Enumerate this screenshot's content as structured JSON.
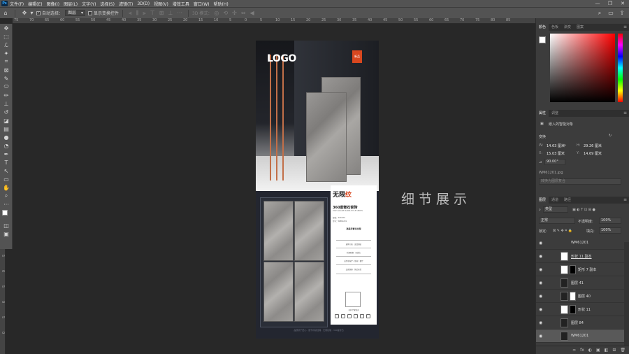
{
  "menubar": {
    "app_icon": "Ps",
    "items": [
      "文件(F)",
      "编辑(E)",
      "图像(I)",
      "图层(L)",
      "文字(Y)",
      "选择(S)",
      "滤镜(T)",
      "3D(D)",
      "视图(V)",
      "增效工具",
      "窗口(W)",
      "帮助(H)"
    ],
    "window_controls": [
      "—",
      "❐",
      "✕"
    ]
  },
  "options": {
    "auto_select_label": "自动选择：",
    "auto_select_value": "图层",
    "show_transform_label": "显示变换控件",
    "mode_3d": "3D 模式："
  },
  "ruler": {
    "h_ticks": [
      "75",
      "70",
      "65",
      "60",
      "55",
      "50",
      "45",
      "40",
      "35",
      "30",
      "25",
      "20",
      "15",
      "10",
      "5",
      "0",
      "5",
      "10",
      "15",
      "20",
      "25",
      "30",
      "35",
      "40",
      "45",
      "50",
      "55",
      "60",
      "65",
      "70",
      "75",
      "80",
      "85"
    ],
    "v_ticks": [
      "5",
      "0",
      "5",
      "0",
      "5",
      "0",
      "5",
      "0",
      "5",
      "0",
      "5",
      "0"
    ]
  },
  "document": {
    "logo": "LOGO",
    "badge": "新品",
    "card": {
      "brand_a": "无限",
      "brand_b": "纹",
      "title": "360度奢石瓷砖",
      "subtitle": "HIGH-GRADE MARBLE TILE SERIES",
      "spec1": "规格：XXXXXX",
      "spec2": "型号：WM61201",
      "lines": [
        "高级灰奢石纹理",
        "通体大板 · 连纹铺贴",
        "防滑耐磨 · 易清洁",
        "适用于客厅 / 卧室 / 餐厅",
        "品质保障 · 售后无忧"
      ],
      "qr_caption": "扫码了解更多"
    },
    "footer": "品质源于匠心 · 细节成就经典 · 无限纹理 · 360度奢石"
  },
  "overlay_text": "细节展示",
  "panels": {
    "color_tabs": [
      "颜色",
      "色板",
      "渐变",
      "图案"
    ],
    "props_tabs": [
      "属性",
      "调整"
    ],
    "smart_object": "嵌入的智能对象",
    "transform_label": "变换",
    "w_label": "W:",
    "w_value": "14.63 厘米",
    "h_label": "H:",
    "h_value": "29.26 厘米",
    "x_label": "X:",
    "x_value": "15.03 厘米",
    "y_label": "Y:",
    "y_value": "14.69 厘米",
    "angle": "90.00°",
    "filename": "WM61201.jpg",
    "convert_btn": "转换为图层复合",
    "layers_tabs": [
      "图层",
      "通道",
      "路径"
    ],
    "kind": "类型",
    "blend": "正常",
    "opacity_label": "不透明度:",
    "opacity": "100%",
    "lock_label": "锁定:",
    "fill_label": "填充:",
    "fill": "100%",
    "layers": [
      "WM61201",
      "形状 11 副本",
      "矩形 7 副本",
      "图层 41",
      "图层 40",
      "形状 11",
      "图层 84",
      "WM61201"
    ],
    "footer_icons": [
      "fx",
      "◐",
      "▣",
      "◧",
      "⊞",
      "🗑"
    ]
  },
  "colors": {
    "accent": "#d8471f",
    "bronze": "#c77a4f",
    "panel": "#3c3c3c"
  }
}
